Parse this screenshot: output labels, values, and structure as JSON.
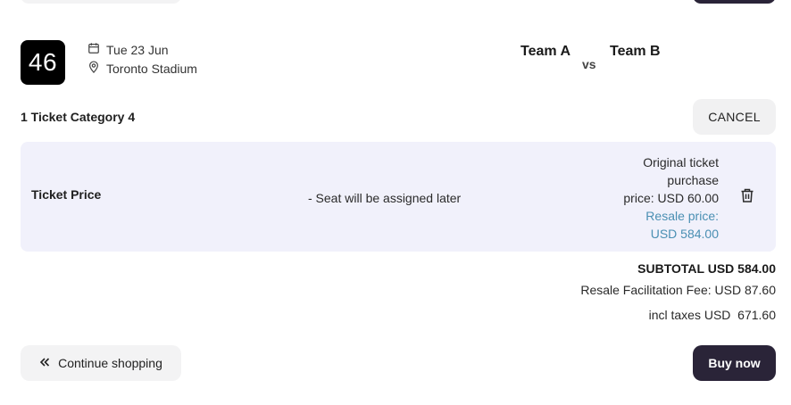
{
  "match": {
    "number": "46",
    "date": "Tue 23 Jun",
    "venue": "Toronto Stadium",
    "team_a": "Team A",
    "vs": "vs",
    "team_b": "Team B"
  },
  "ticket": {
    "category": "1 Ticket Category 4",
    "cancel_label": "CANCEL",
    "price_label": "Ticket Price",
    "seat_note": "- Seat will be assigned later",
    "original_price_line1": "Original ticket",
    "original_price_line2": "purchase",
    "original_price_line3": "price: USD 60.00",
    "resale_line1": "Resale price:",
    "resale_line2": "USD 584.00"
  },
  "totals": {
    "subtotal": "SUBTOTAL USD 584.00",
    "fee": "Resale Facilitation Fee: USD 87.60",
    "incl_taxes": "incl taxes USD  671.60"
  },
  "actions": {
    "continue_label": "Continue shopping",
    "buy_label": "Buy now"
  },
  "icons": {
    "calendar": "calendar-icon",
    "location": "location-pin-icon",
    "delete": "trash-icon",
    "back": "double-chevron-left-icon"
  },
  "colors": {
    "primary_dark": "#2a2438",
    "panel_bg": "#f1f1fb",
    "resale_text": "#4a8fb3"
  }
}
